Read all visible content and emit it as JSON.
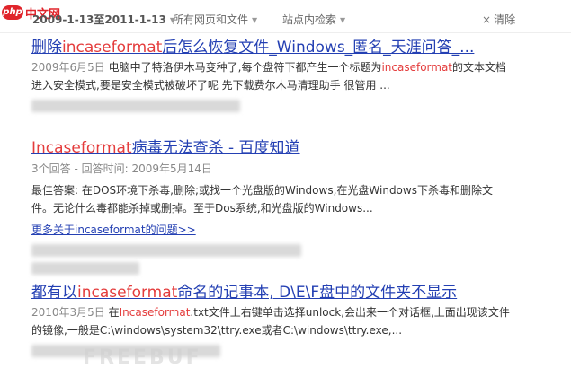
{
  "logo": {
    "php": "php",
    "cn": "中文网"
  },
  "filters": {
    "time_range": "2009-1-13至2011-1-13",
    "site_scope_all": "所有网页和文件",
    "site_scope_in": "站点内检索",
    "clear_label": "清除",
    "clear_icon": "×"
  },
  "results": [
    {
      "title": {
        "before": "删除",
        "highlight": "incaseformat",
        "after": "后怎么恢复文件_Windows_匿名_天涯问答_..."
      },
      "date": "2009年6月5日",
      "abstract_line1": {
        "before": " 电脑中了特洛伊木马变种了,每个盘符下都产生一个标题为",
        "highlight": "incaseformat",
        "after": "的文本文档"
      },
      "abstract_line2": "进入安全模式,要是安全模式被破坏了呢 先下载费尔木马清理助手 很管用 ..."
    },
    {
      "title": {
        "highlight": "Incaseformat",
        "after": "病毒无法查杀 - 百度知道"
      },
      "sub_meta": "3个回答 - 回答时间: 2009年5月14日",
      "abstract_line1": "最佳答案: 在DOS环境下杀毒,删除;或找一个光盘版的Windows,在光盘Windows下杀毒和删除文",
      "abstract_line2": "件。无论什么毒都能杀掉或删掉。至于Dos系统,和光盘版的Windows...",
      "more_link": "更多关于incaseformat的问题>>"
    },
    {
      "title": {
        "before": "都有以",
        "highlight": "incaseformat",
        "after": "命名的记事本, D\\E\\F盘中的文件夹不显示"
      },
      "date": "2010年3月5日",
      "abstract_line1": {
        "before": " 在",
        "highlight": "Incaseformat",
        "after": ".txt文件上右键单击选择unlock,会出来一个对话框,上面出现该文件"
      },
      "abstract_line2": "的镜像,一般是C:\\windows\\system32\\ttry.exe或者C:\\windows\\ttry.exe,..."
    }
  ],
  "watermark": "FREEBUF"
}
